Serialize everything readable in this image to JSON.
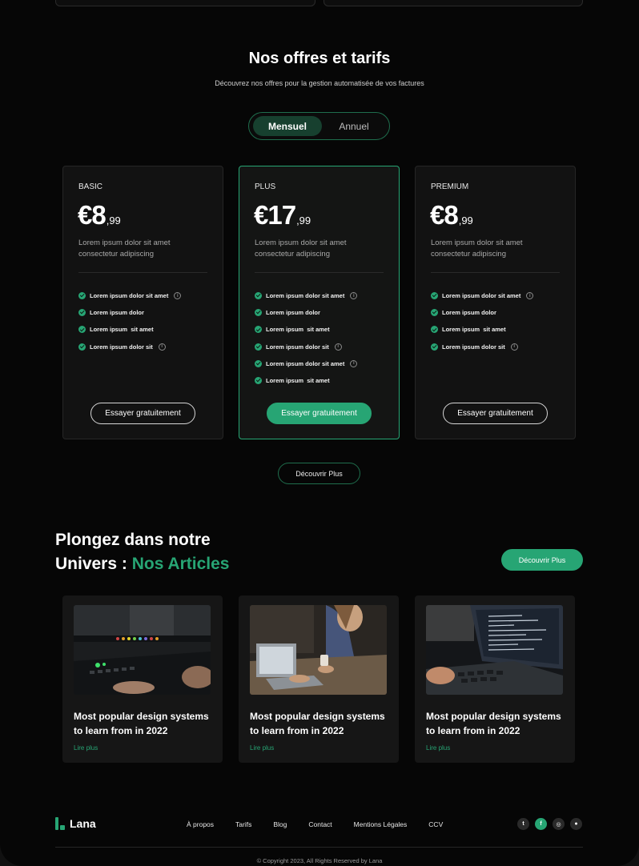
{
  "pricing": {
    "title": "Nos offres et tarifs",
    "subtitle": "Découvrez nos offres pour la gestion automatisée de vos factures",
    "toggle": {
      "monthly": "Mensuel",
      "yearly": "Annuel",
      "selected": "Mensuel"
    },
    "plans": [
      {
        "name": "BASIC",
        "price": "€8",
        "cents": ",99",
        "description": "Lorem ipsum dolor sit amet consectetur adipiscing",
        "features": [
          {
            "text": "Lorem ipsum dolor sit amet",
            "info": true
          },
          {
            "text": "Lorem ipsum dolor",
            "info": false
          },
          {
            "text": "Lorem ipsum  sit amet",
            "info": false
          },
          {
            "text": "Lorem ipsum dolor sit",
            "info": true
          }
        ],
        "cta": "Essayer gratuitement"
      },
      {
        "name": "PLUS",
        "price": "€17",
        "cents": ",99",
        "description": "Lorem ipsum dolor sit amet consectetur adipiscing",
        "features": [
          {
            "text": "Lorem ipsum dolor sit amet",
            "info": true
          },
          {
            "text": "Lorem ipsum dolor",
            "info": false
          },
          {
            "text": "Lorem ipsum  sit amet",
            "info": false
          },
          {
            "text": "Lorem ipsum dolor sit",
            "info": true
          },
          {
            "text": "Lorem ipsum dolor sit amet",
            "info": true
          },
          {
            "text": "Lorem ipsum  sit amet",
            "info": false
          }
        ],
        "cta": "Essayer gratuitement"
      },
      {
        "name": "PREMIUM",
        "price": "€8",
        "cents": ",99",
        "description": "Lorem ipsum dolor sit amet consectetur adipiscing",
        "features": [
          {
            "text": "Lorem ipsum dolor sit amet",
            "info": true
          },
          {
            "text": "Lorem ipsum dolor",
            "info": false
          },
          {
            "text": "Lorem ipsum  sit amet",
            "info": false
          },
          {
            "text": "Lorem ipsum dolor sit",
            "info": true
          }
        ],
        "cta": "Essayer gratuitement"
      }
    ],
    "discover": "Découvrir Plus"
  },
  "articles": {
    "title_line1": "Plongez dans notre",
    "title_prefix": "Univers : ",
    "title_accent": "Nos Articles",
    "discover": "Découvrir Plus",
    "items": [
      {
        "title": "Most popular design systems to learn from in 2022",
        "link": "Lire plus",
        "image": "audio-mixing-console-photo"
      },
      {
        "title": "Most popular design systems to learn from in 2022",
        "link": "Lire plus",
        "image": "woman-typing-on-laptop-photo"
      },
      {
        "title": "Most popular design systems to learn from in 2022",
        "link": "Lire plus",
        "image": "code-on-laptop-photo"
      }
    ]
  },
  "footer": {
    "logo": "Lana",
    "nav": [
      "À propos",
      "Tarifs",
      "Blog",
      "Contact",
      "Mentions Légales",
      "CCV"
    ],
    "socials": [
      {
        "icon": "twitter-icon",
        "glyph": "t"
      },
      {
        "icon": "facebook-icon",
        "glyph": "f"
      },
      {
        "icon": "instagram-icon",
        "glyph": "◎"
      },
      {
        "icon": "github-icon",
        "glyph": "●"
      }
    ],
    "copyright": "© Copyright 2023, All Rights Reserved by Lana"
  },
  "colors": {
    "accent": "#27a574",
    "background": "#060606",
    "card": "#121212"
  }
}
